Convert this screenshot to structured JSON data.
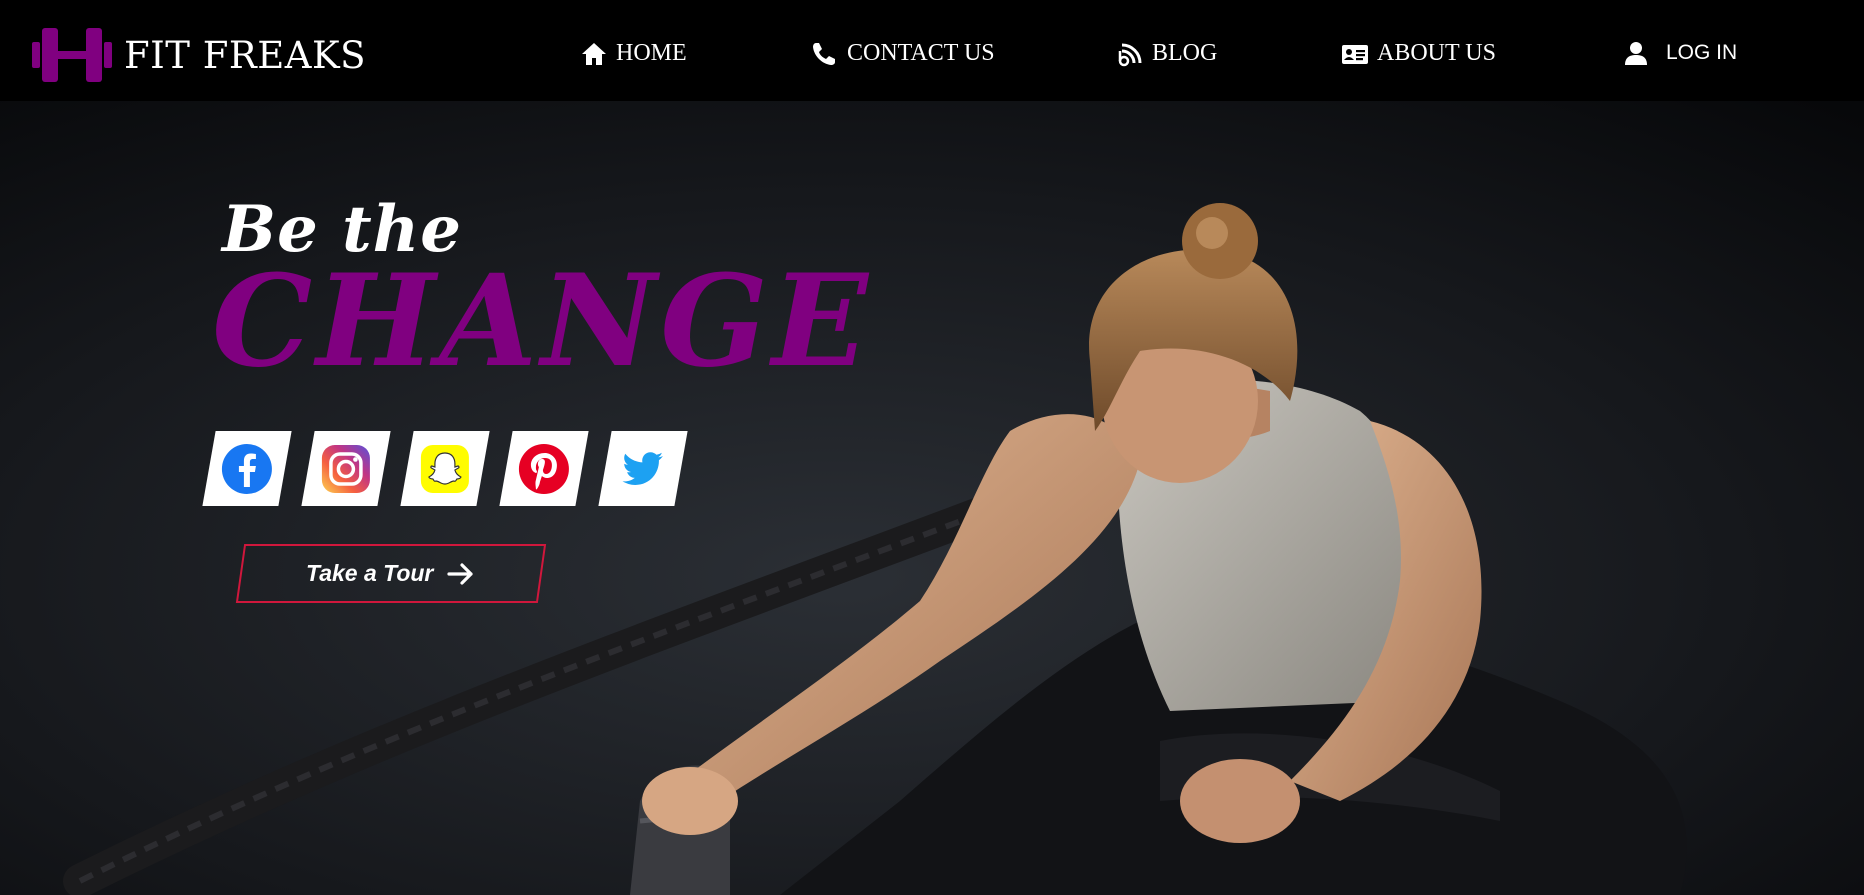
{
  "brand": {
    "name": "FIT FREAKS",
    "accent": "#800080"
  },
  "nav": {
    "items": [
      {
        "label": "HOME",
        "icon": "home-icon"
      },
      {
        "label": "CONTACT US",
        "icon": "phone-icon"
      },
      {
        "label": "BLOG",
        "icon": "blog-icon"
      },
      {
        "label": "ABOUT US",
        "icon": "id-card-icon"
      },
      {
        "label": "LOG IN",
        "icon": "user-icon"
      }
    ]
  },
  "hero": {
    "line1": "Be the",
    "line2": "CHANGE",
    "socials": [
      "facebook-icon",
      "instagram-icon",
      "snapchat-icon",
      "pinterest-icon",
      "twitter-icon"
    ],
    "cta": {
      "label": "Take a Tour",
      "icon": "arrow-right-icon",
      "border_color": "#d0173c"
    }
  }
}
